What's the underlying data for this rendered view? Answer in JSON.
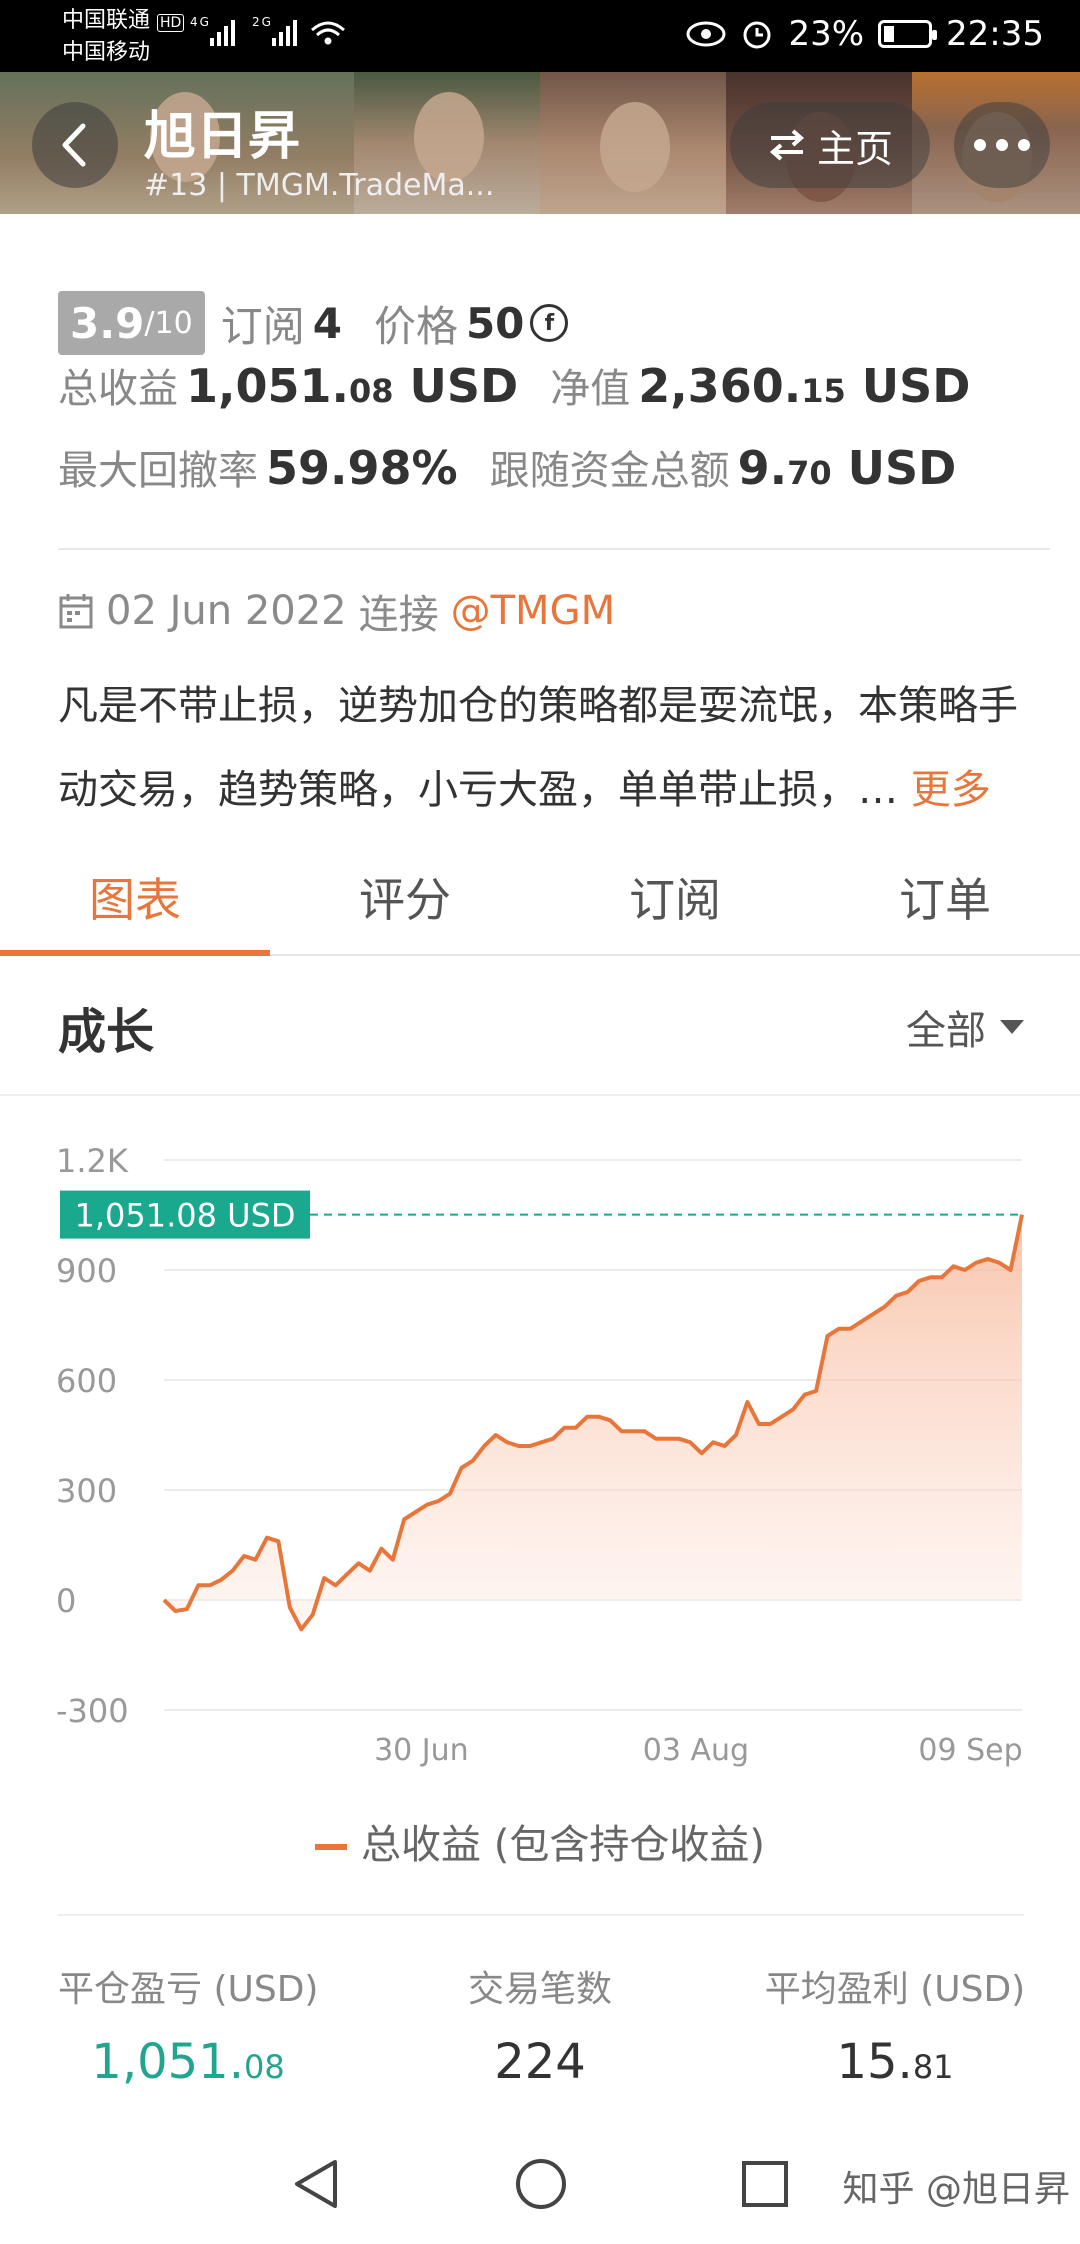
{
  "status_bar": {
    "carrier1": "中国联通",
    "carrier2": "中国移动",
    "hd": "HD",
    "signal": "4G  2G",
    "battery": "23%",
    "time": "22:35"
  },
  "header": {
    "title": "旭日昇",
    "subtitle": "#13 | TMGM.TradeMa...",
    "home_label": "主页"
  },
  "summary": {
    "rating": "3.9",
    "rating_max": "/10",
    "subscribe_label": "订阅",
    "subscribe_count": "4",
    "price_label": "价格",
    "price_value": "50",
    "price_coin": "f",
    "total_profit_label": "总收益",
    "total_profit_int": "1,051.",
    "total_profit_dec": "08",
    "total_profit_unit": "USD",
    "net_value_label": "净值",
    "net_value_int": "2,360.",
    "net_value_dec": "15",
    "net_value_unit": "USD",
    "max_drawdown_label": "最大回撤率",
    "max_drawdown_value": "59.98%",
    "follow_funds_label": "跟随资金总额",
    "follow_funds_int": "9.",
    "follow_funds_dec": "70",
    "follow_funds_unit": "USD"
  },
  "connection": {
    "date": "02 Jun 2022",
    "connect_label": "连接",
    "broker": "@TMGM"
  },
  "description": {
    "line1": "凡是不带止损，逆势加仓的策略都是耍流氓，本策略手",
    "line2": "动交易，趋势策略，小亏大盈，单单带止损，…",
    "more": "更多"
  },
  "tabs": [
    {
      "label": "图表",
      "active": true
    },
    {
      "label": "评分",
      "active": false
    },
    {
      "label": "订阅",
      "active": false
    },
    {
      "label": "订单",
      "active": false
    }
  ],
  "section": {
    "title": "成长",
    "range": "全部"
  },
  "chart_data": {
    "type": "area",
    "ylim": [
      -300,
      1200
    ],
    "yticks": [
      "1.2K",
      "900",
      "600",
      "300",
      "0",
      "-300"
    ],
    "ytick_values": [
      1200,
      900,
      600,
      300,
      0,
      -300
    ],
    "xticks": [
      "30 Jun",
      "03 Aug",
      "09 Sep"
    ],
    "last_value_label": "1,051.08 USD",
    "last_value": 1051.08,
    "color": "#e8763a",
    "label_color": "#1aa88e",
    "series": [
      {
        "name": "总收益 (包含持仓收益)",
        "values": [
          0,
          -30,
          -25,
          40,
          40,
          55,
          80,
          120,
          110,
          170,
          160,
          -20,
          -80,
          -40,
          60,
          40,
          70,
          100,
          80,
          140,
          110,
          220,
          240,
          260,
          270,
          290,
          360,
          380,
          420,
          450,
          430,
          420,
          420,
          430,
          440,
          470,
          470,
          500,
          500,
          490,
          460,
          460,
          460,
          440,
          440,
          440,
          430,
          400,
          430,
          420,
          450,
          540,
          480,
          480,
          500,
          520,
          560,
          570,
          720,
          740,
          740,
          760,
          780,
          800,
          830,
          840,
          870,
          880,
          880,
          910,
          900,
          920,
          930,
          920,
          900,
          1051.08
        ]
      }
    ]
  },
  "legend": {
    "label": "总收益 (包含持仓收益)"
  },
  "bottom_stats": {
    "closed_pl_label": "平仓盈亏 (USD)",
    "closed_pl_int": "1,051.",
    "closed_pl_dec": "08",
    "trades_label": "交易笔数",
    "trades_value": "224",
    "avg_profit_label": "平均盈利 (USD)",
    "avg_profit_int": "15.",
    "avg_profit_dec": "81"
  },
  "watermark": "知乎 @旭日昇"
}
